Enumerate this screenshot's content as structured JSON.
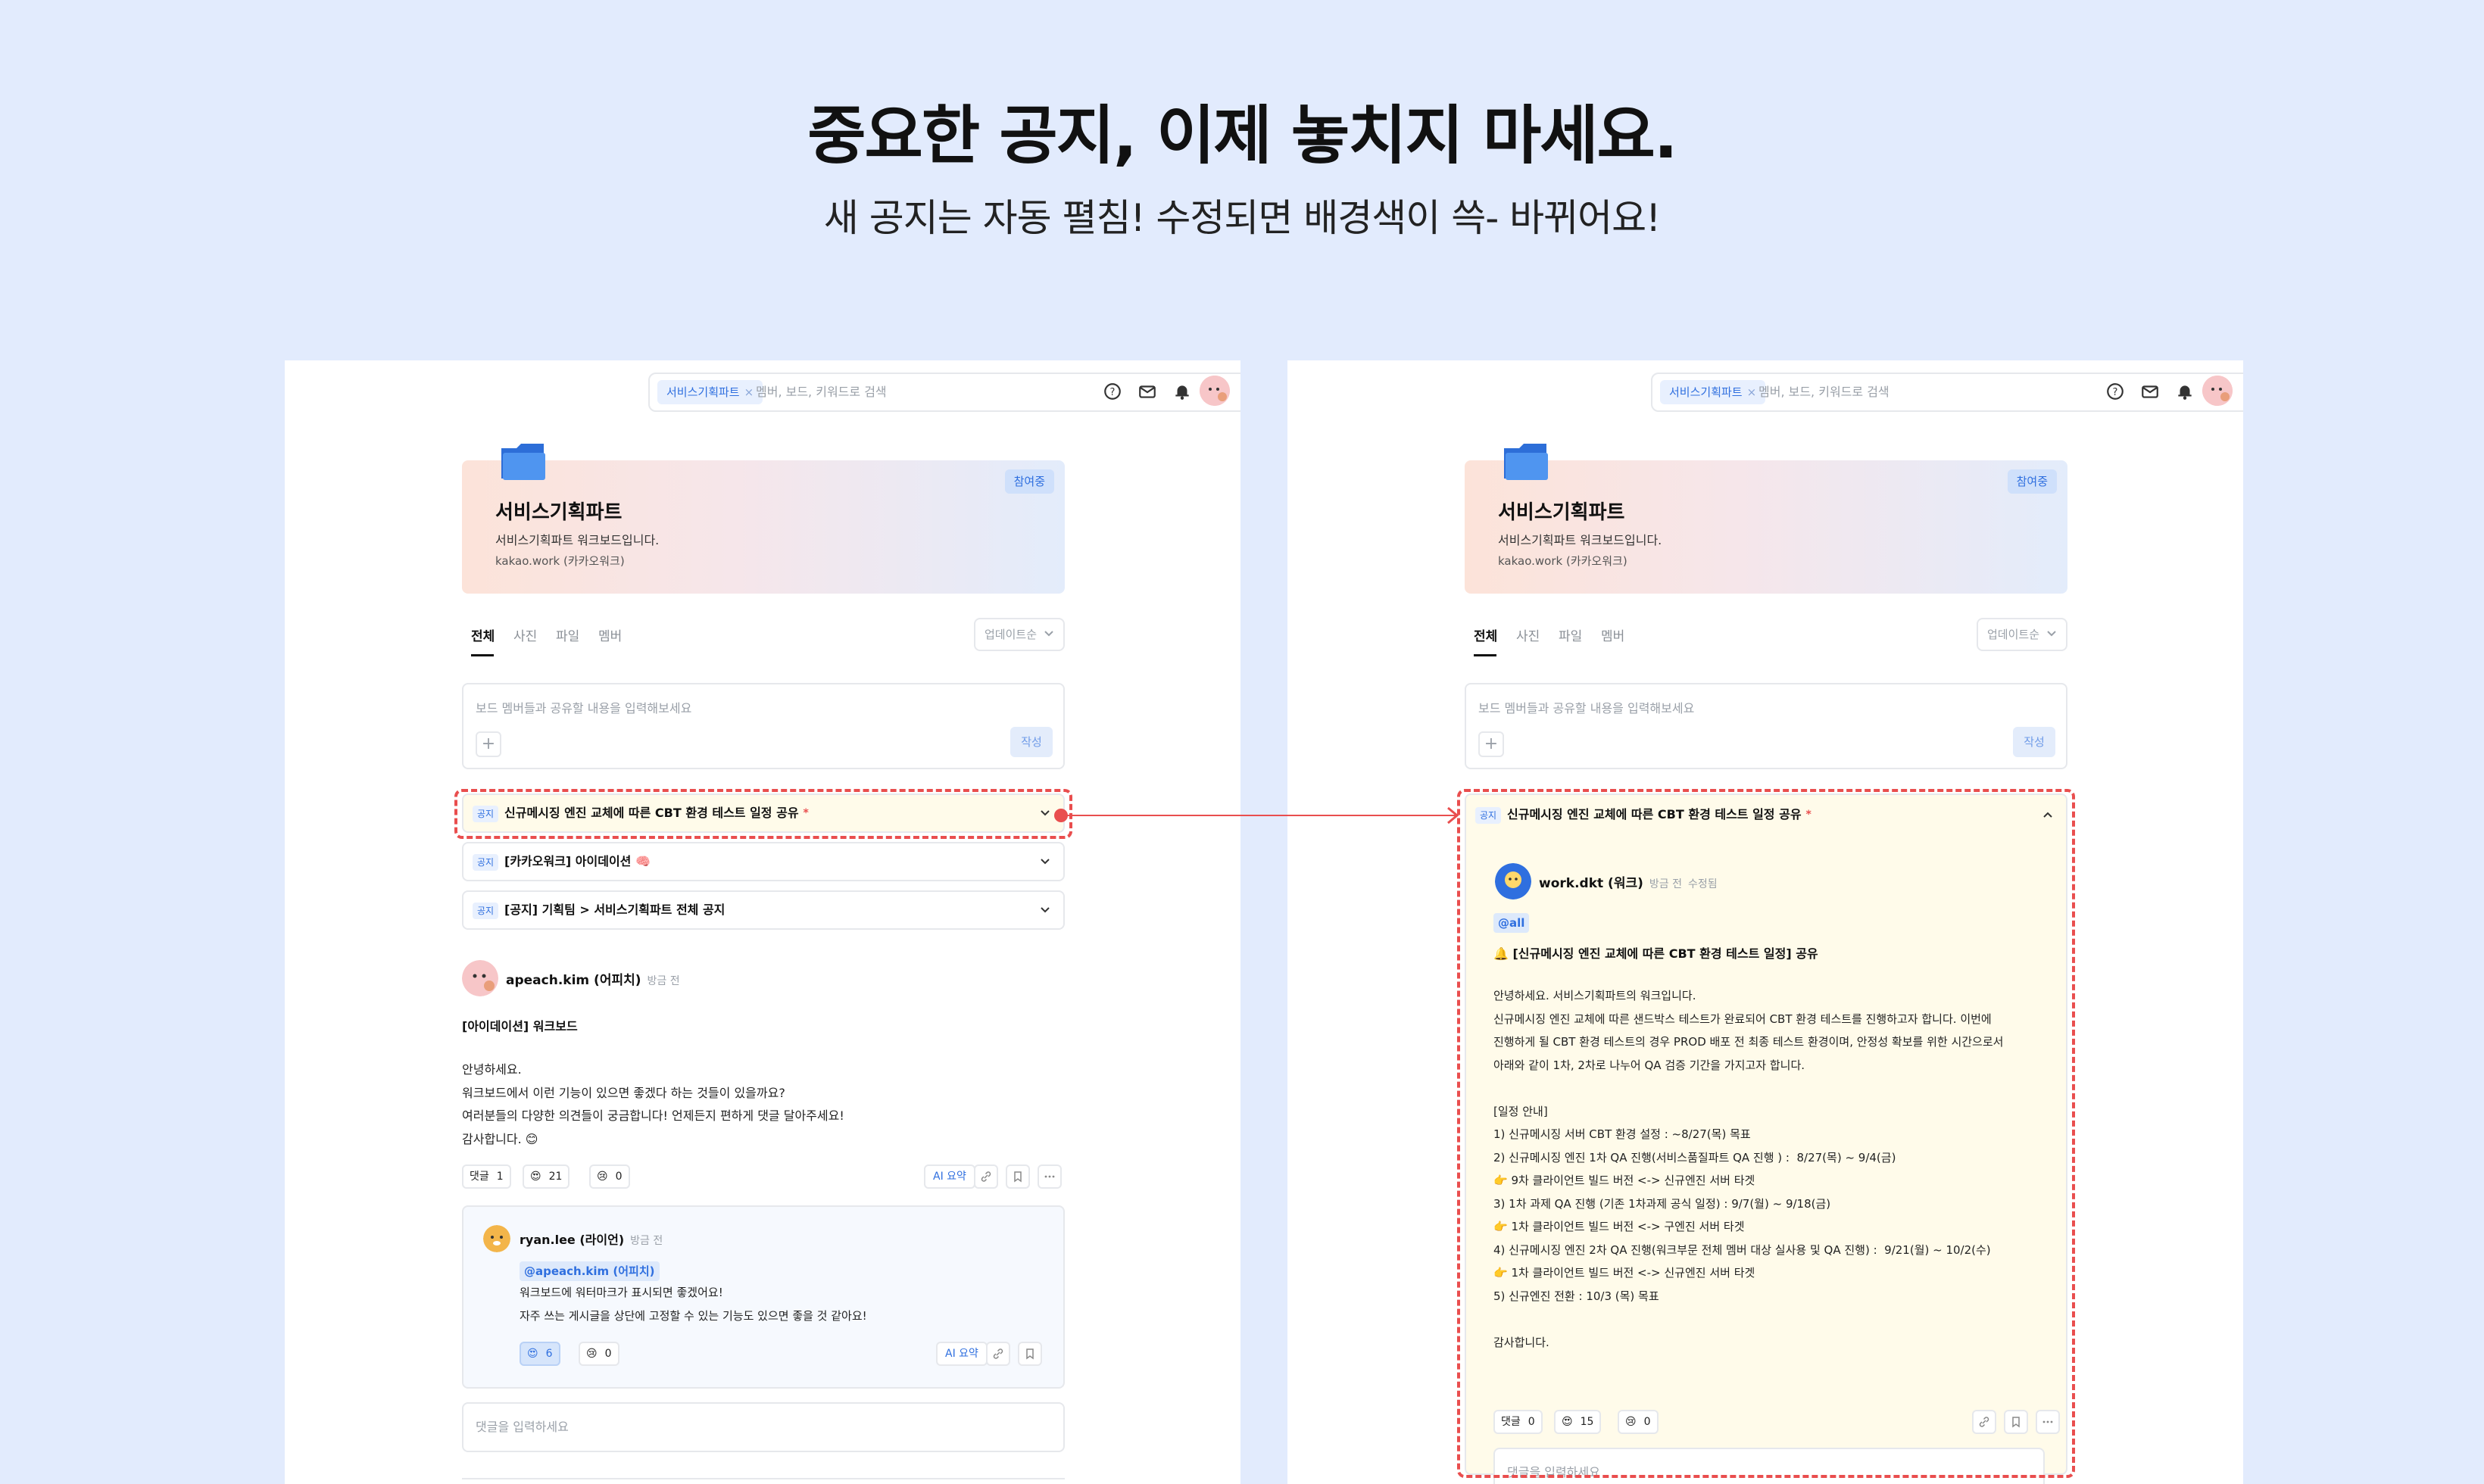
{
  "hero": {
    "title": "중요한 공지, 이제 놓치지 마세요.",
    "subtitle": "새 공지는 자동 펼침! 수정되면 배경색이 쓱- 바뀌어요!"
  },
  "topbar": {
    "chip": "서비스기획파트",
    "search_placeholder": "멤버, 보드, 키워드로 검색",
    "icons": [
      "help-icon",
      "mail-icon",
      "bell-icon",
      "avatar"
    ]
  },
  "board": {
    "badge": "참여중",
    "title": "서비스기획파트",
    "description": "서비스기획파트 워크보드입니다.",
    "domain": "kakao.work (카카오워크)"
  },
  "tabs": [
    "전체",
    "사진",
    "파일",
    "멤버"
  ],
  "sort": "업데이트순",
  "composer": {
    "placeholder": "보드 멤버들과 공유할 내용을 입력해보세요",
    "write": "작성"
  },
  "notice_tag": "공지",
  "notices": [
    "신규메시징 엔진 교체에 따른 CBT 환경 테스트 일정 공유",
    "[카카오워크] 아이데이션 🧠",
    "[공지] 기획팀 > 서비스기획파트 전체 공지"
  ],
  "left_post": {
    "author": "apeach.kim (어피치)",
    "time": "방금 전",
    "title": "[아이데이션] 워크보드",
    "body": "안녕하세요.\n워크보드에서 이런 기능이 있으면 좋겠다 하는 것들이 있을까요?\n여러분들의 다양한 의견들이 궁금합니다! 언제든지 편하게 댓글 달아주세요!\n감사합니다. 😊",
    "comment_label": "댓글",
    "comment_count": "1",
    "heart_count": "21",
    "sad_count": "0",
    "ai_label": "AI 요약"
  },
  "reply": {
    "author": "ryan.lee (라이언)",
    "time": "방금 전",
    "mention": "@apeach.kim (어피치)",
    "body": "워크보드에 워터마크가 표시되면 좋겠어요!\n자주 쓰는 게시글을 상단에 고정할 수 있는 기능도 있으면 좋을 것 같아요!",
    "heart_count": "6",
    "sad_count": "0",
    "ai_label": "AI 요약"
  },
  "comment_placeholder": "댓글을 입력하세요",
  "right_post": {
    "author": "work.dkt (워크)",
    "time": "방금 전",
    "edited": "수정됨",
    "mention": "@all",
    "title": "🔔 [신규메시징 엔진 교체에 따른 CBT 환경 테스트 일정] 공유",
    "body": "안녕하세요. 서비스기획파트의 워크입니다.\n신규메시징 엔진 교체에 따른 샌드박스 테스트가 완료되어 CBT 환경 테스트를 진행하고자 합니다. 이번에\n진행하게 될 CBT 환경 테스트의 경우 PROD 배포 전 최종 테스트 환경이며, 안정성 확보를 위한 시간으로서\n아래와 같이 1차, 2차로 나누어 QA 검증 기간을 가지고자 합니다.\n\n[일정 안내]\n1) 신규메시징 서버 CBT 환경 설정 : ~8/27(목) 목표\n2) 신규메시징 엔진 1차 QA 진행(서비스품질파트 QA 진행 ) :  8/27(목) ~ 9/4(금)\n👉 9차 클라이언트 빌드 버전 <-> 신규엔진 서버 타겟\n3) 1차 과제 QA 진행 (기존 1차과제 공식 일정) : 9/7(월) ~ 9/18(금)\n👉 1차 클라이언트 빌드 버전 <-> 구엔진 서버 타겟\n4) 신규메시징 엔진 2차 QA 진행(워크부문 전체 멤버 대상 실사용 및 QA 진행) :  9/21(월) ~ 10/2(수)\n👉 1차 클라이언트 빌드 버전 <-> 신규엔진 서버 타겟\n5) 신규엔진 전환 : 10/3 (목) 목표\n\n감사합니다.",
    "comment_label": "댓글",
    "comment_count": "0",
    "heart_count": "15",
    "sad_count": "0"
  },
  "colors": {
    "background": "#e2ebfd",
    "accent": "#2f6fdf",
    "highlight": "#e94e4e",
    "notice_bg": "#fffbea"
  }
}
